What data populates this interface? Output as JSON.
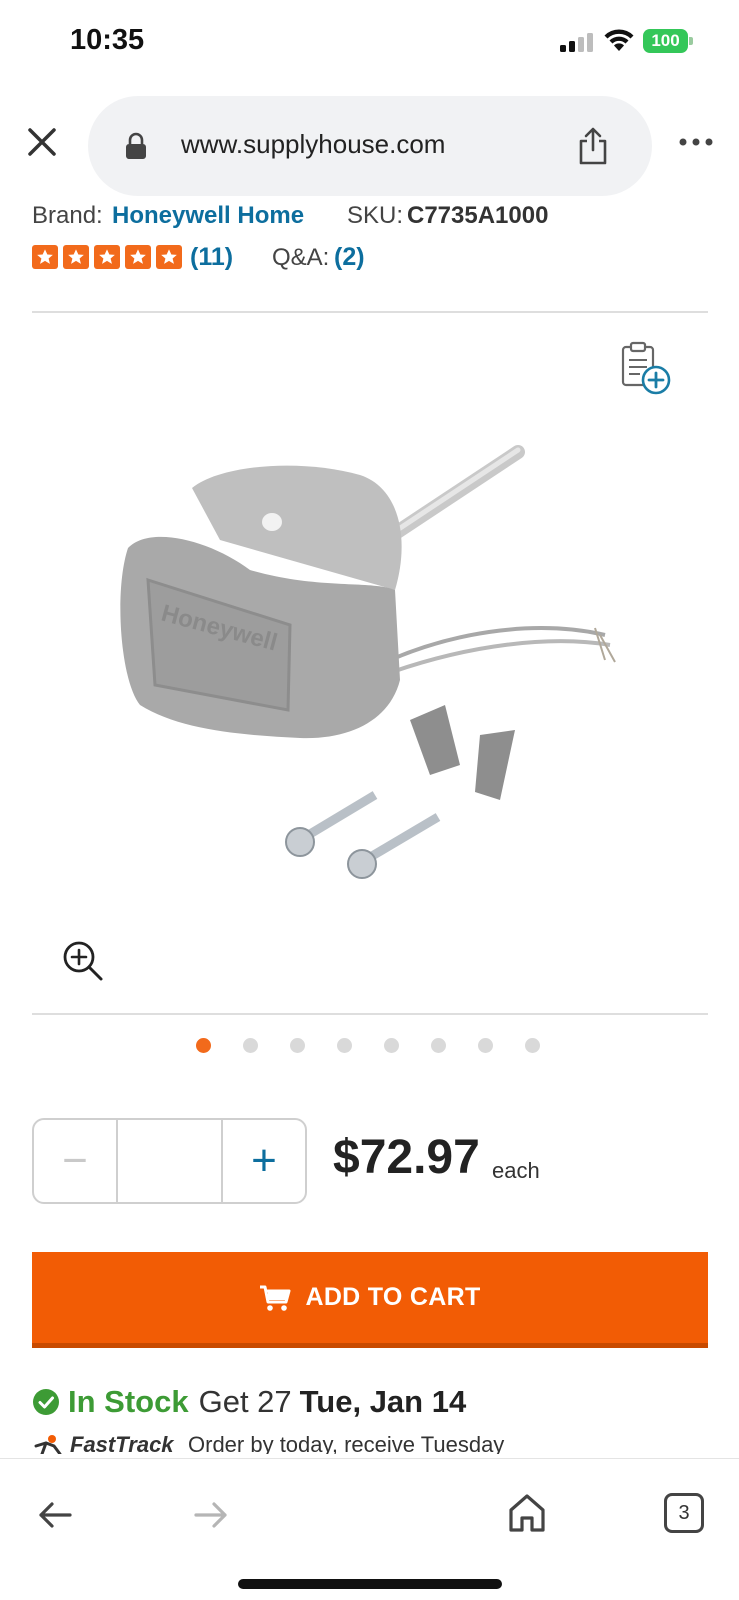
{
  "status_bar": {
    "time": "10:35",
    "battery": "100"
  },
  "browser": {
    "url": "www.supplyhouse.com",
    "tabs_count": "3"
  },
  "product": {
    "brand_label": "Brand:",
    "brand_value": "Honeywell Home",
    "sku_label": "SKU:",
    "sku_value": "C7735A1000",
    "rating_stars": 5,
    "review_count": "(11)",
    "qa_label": "Q&A:",
    "qa_count": "(2)",
    "image_alt": "Honeywell",
    "gallery_count": 8,
    "gallery_active_index": 0
  },
  "purchase": {
    "qty_minus": "−",
    "qty_plus": "+",
    "qty_value": "",
    "price": "$72.97",
    "price_unit": "each",
    "add_to_cart_label": "ADD TO CART"
  },
  "stock": {
    "status": "In Stock",
    "get_text": "Get 27",
    "date": "Tue, Jan 14"
  },
  "fasttrack": {
    "brand": "FastTrack",
    "text": "Order by today, receive Tuesday"
  },
  "colors": {
    "accent": "#f25c05",
    "link": "#0d6e9e",
    "in_stock": "#3d9b35"
  }
}
